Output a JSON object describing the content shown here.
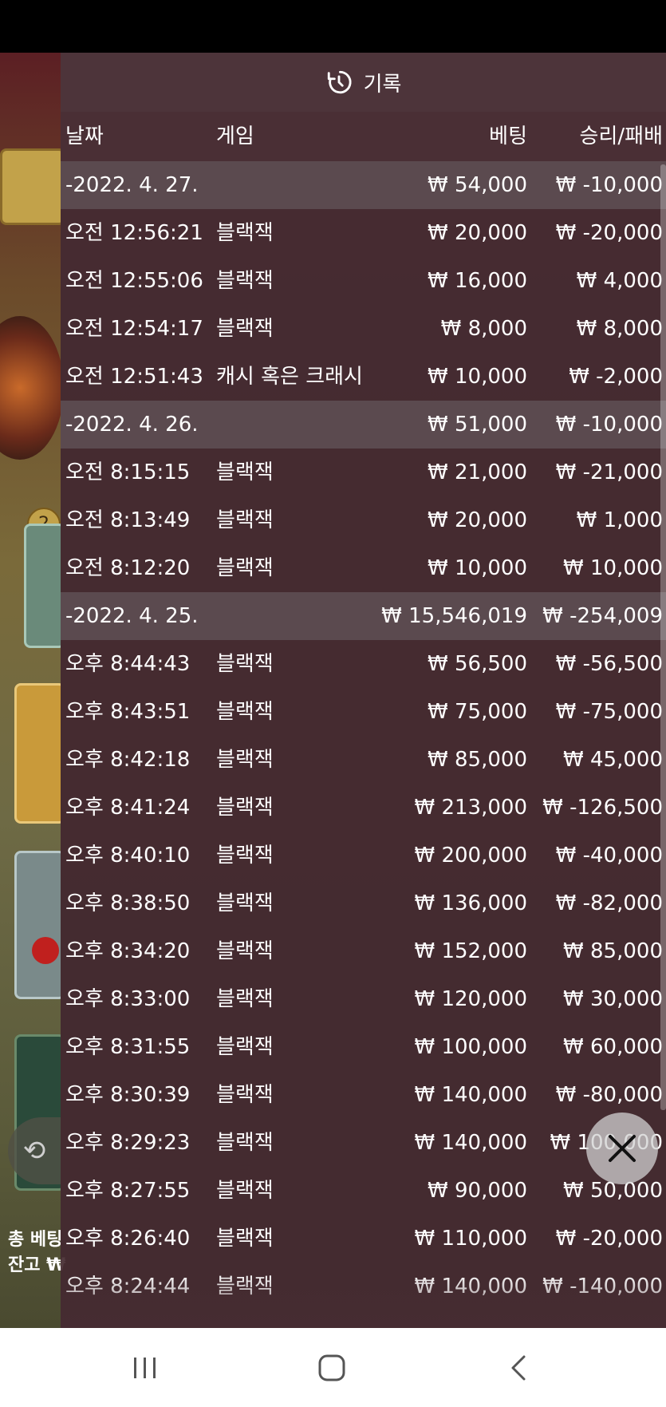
{
  "panel": {
    "title": "기록",
    "icon": "history-icon"
  },
  "columns": {
    "date": "날짜",
    "game": "게임",
    "bet": "베팅",
    "win_loss": "승리/패배"
  },
  "rows": [
    {
      "type": "group",
      "date": "-2022. 4. 27.",
      "game": "",
      "bet": "₩ 54,000",
      "win_loss": "₩ -10,000"
    },
    {
      "type": "entry",
      "date": "오전 12:56:21",
      "game": "블랙잭",
      "bet": "₩ 20,000",
      "win_loss": "₩ -20,000"
    },
    {
      "type": "entry",
      "date": "오전 12:55:06",
      "game": "블랙잭",
      "bet": "₩ 16,000",
      "win_loss": "₩ 4,000"
    },
    {
      "type": "entry",
      "date": "오전 12:54:17",
      "game": "블랙잭",
      "bet": "₩ 8,000",
      "win_loss": "₩ 8,000"
    },
    {
      "type": "entry",
      "date": "오전 12:51:43",
      "game": "캐시 혹은 크래시",
      "bet": "₩ 10,000",
      "win_loss": "₩ -2,000"
    },
    {
      "type": "group",
      "date": "-2022. 4. 26.",
      "game": "",
      "bet": "₩ 51,000",
      "win_loss": "₩ -10,000"
    },
    {
      "type": "entry",
      "date": "오전 8:15:15",
      "game": "블랙잭",
      "bet": "₩ 21,000",
      "win_loss": "₩ -21,000"
    },
    {
      "type": "entry",
      "date": "오전 8:13:49",
      "game": "블랙잭",
      "bet": "₩ 20,000",
      "win_loss": "₩ 1,000"
    },
    {
      "type": "entry",
      "date": "오전 8:12:20",
      "game": "블랙잭",
      "bet": "₩ 10,000",
      "win_loss": "₩ 10,000"
    },
    {
      "type": "group",
      "date": "-2022. 4. 25.",
      "game": "",
      "bet": "₩ 15,546,019",
      "win_loss": "₩ -254,009"
    },
    {
      "type": "entry",
      "date": "오후 8:44:43",
      "game": "블랙잭",
      "bet": "₩ 56,500",
      "win_loss": "₩ -56,500"
    },
    {
      "type": "entry",
      "date": "오후 8:43:51",
      "game": "블랙잭",
      "bet": "₩ 75,000",
      "win_loss": "₩ -75,000"
    },
    {
      "type": "entry",
      "date": "오후 8:42:18",
      "game": "블랙잭",
      "bet": "₩ 85,000",
      "win_loss": "₩ 45,000"
    },
    {
      "type": "entry",
      "date": "오후 8:41:24",
      "game": "블랙잭",
      "bet": "₩ 213,000",
      "win_loss": "₩ -126,500"
    },
    {
      "type": "entry",
      "date": "오후 8:40:10",
      "game": "블랙잭",
      "bet": "₩ 200,000",
      "win_loss": "₩ -40,000"
    },
    {
      "type": "entry",
      "date": "오후 8:38:50",
      "game": "블랙잭",
      "bet": "₩ 136,000",
      "win_loss": "₩ -82,000"
    },
    {
      "type": "entry",
      "date": "오후 8:34:20",
      "game": "블랙잭",
      "bet": "₩ 152,000",
      "win_loss": "₩ 85,000"
    },
    {
      "type": "entry",
      "date": "오후 8:33:00",
      "game": "블랙잭",
      "bet": "₩ 120,000",
      "win_loss": "₩ 30,000"
    },
    {
      "type": "entry",
      "date": "오후 8:31:55",
      "game": "블랙잭",
      "bet": "₩ 100,000",
      "win_loss": "₩ 60,000"
    },
    {
      "type": "entry",
      "date": "오후 8:30:39",
      "game": "블랙잭",
      "bet": "₩ 140,000",
      "win_loss": "₩ -80,000"
    },
    {
      "type": "entry",
      "date": "오후 8:29:23",
      "game": "블랙잭",
      "bet": "₩ 140,000",
      "win_loss": "₩ 100,000"
    },
    {
      "type": "entry",
      "date": "오후 8:27:55",
      "game": "블랙잭",
      "bet": "₩ 90,000",
      "win_loss": "₩ 50,000"
    },
    {
      "type": "entry",
      "date": "오후 8:26:40",
      "game": "블랙잭",
      "bet": "₩ 110,000",
      "win_loss": "₩ -20,000"
    },
    {
      "type": "entry",
      "date": "오후 8:24:44",
      "game": "블랙잭",
      "bet": "₩ 140,000",
      "win_loss": "₩ -140,000"
    }
  ],
  "background": {
    "total_bet_label": "총 베팅",
    "balance_label": "잔고 ₩",
    "chip_number": "2"
  },
  "buttons": {
    "close_icon": "close-icon",
    "refresh_icon": "refresh-icon"
  },
  "nav": {
    "recent_icon": "recent-apps-icon",
    "home_icon": "home-icon",
    "back_icon": "back-icon"
  },
  "colors": {
    "panel_bg": "#462c32",
    "group_row_bg": "#5b4a4f",
    "text": "#ffffff"
  }
}
